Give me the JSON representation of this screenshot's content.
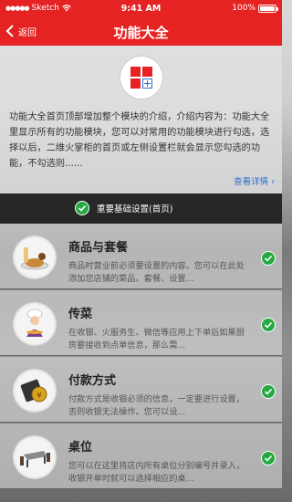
{
  "status_bar": {
    "carrier": "Sketch",
    "time": "9:41 AM",
    "battery": "100%"
  },
  "nav": {
    "back_label": "返回",
    "title": "功能大全"
  },
  "intro": {
    "text": "功能大全首页顶部增加整个模块的介绍，介绍内容为：功能大全里显示所有的功能模块，您可以对常用的功能模块进行勾选，选择以后，二维火掌柜的首页或左侧设置栏就会显示您勾选的功能，不勾选则......",
    "more_label": "查看详情 ›"
  },
  "base_setting": {
    "label": "重要基础设置(首页)"
  },
  "modules": [
    {
      "title": "商品与套餐",
      "desc": "商品时营业前必须要设置的内容。您可以在此处添加您店铺的菜品、套餐、设置..."
    },
    {
      "title": "传菜",
      "desc": "在收银、火服务生、微信等应用上下单后如果厨房要接收到点单信息，那么需..."
    },
    {
      "title": "付款方式",
      "desc": "付款方式是收银必须的信息，一定要进行设置，否则收银无法操作。您可以设..."
    },
    {
      "title": "桌位",
      "desc": "您可以在这里将店内所有桌位分别编号并录入，收银开单时就可以选择相应的桌..."
    }
  ],
  "colors": {
    "brand_red": "#e52322",
    "check_green": "#25a940",
    "link_blue": "#2a6fd0"
  }
}
